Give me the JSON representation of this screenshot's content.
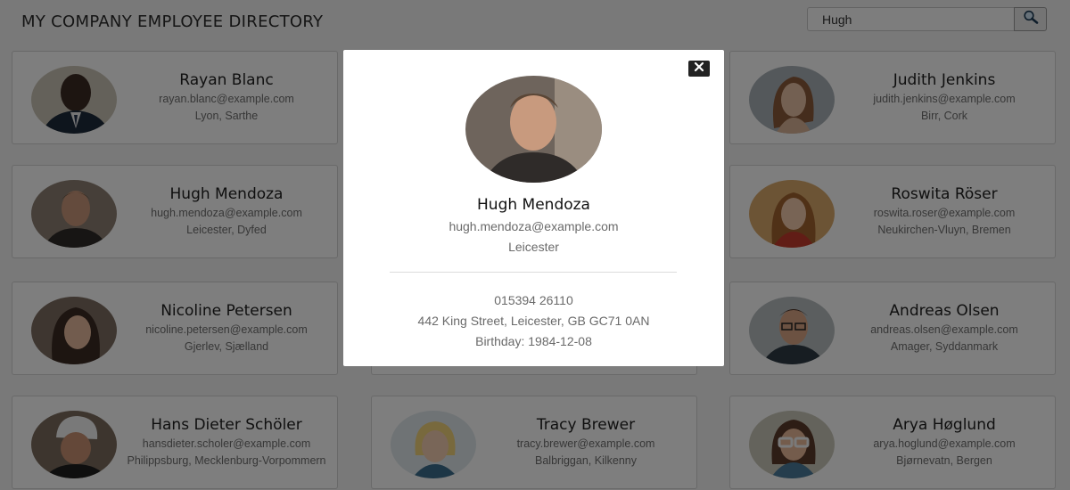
{
  "header": {
    "title": "MY COMPANY EMPLOYEE DIRECTORY",
    "search_value": "Hugh",
    "search_icon": "magnifier-icon"
  },
  "employees": [
    {
      "name": "Rayan Blanc",
      "email": "rayan.blanc@example.com",
      "location": "Lyon, Sarthe"
    },
    {
      "name": "",
      "email": "",
      "location": ""
    },
    {
      "name": "Judith Jenkins",
      "email": "judith.jenkins@example.com",
      "location": "Birr, Cork"
    },
    {
      "name": "Hugh Mendoza",
      "email": "hugh.mendoza@example.com",
      "location": "Leicester, Dyfed"
    },
    {
      "name": "",
      "email": "",
      "location": ""
    },
    {
      "name": "Roswita Röser",
      "email": "roswita.roser@example.com",
      "location": "Neukirchen-Vluyn, Bremen"
    },
    {
      "name": "Nicoline Petersen",
      "email": "nicoline.petersen@example.com",
      "location": "Gjerlev, Sjælland"
    },
    {
      "name": "",
      "email": "",
      "location": ""
    },
    {
      "name": "Andreas Olsen",
      "email": "andreas.olsen@example.com",
      "location": "Amager, Syddanmark"
    },
    {
      "name": "Hans Dieter Schöler",
      "email": "hansdieter.scholer@example.com",
      "location": "Philippsburg, Mecklenburg-Vorpommern"
    },
    {
      "name": "Tracy Brewer",
      "email": "tracy.brewer@example.com",
      "location": "Balbriggan, Kilkenny"
    },
    {
      "name": "Arya Høglund",
      "email": "arya.hoglund@example.com",
      "location": "Bjørnevatn, Bergen"
    }
  ],
  "modal": {
    "name": "Hugh Mendoza",
    "email": "hugh.mendoza@example.com",
    "city": "Leicester",
    "phone": "015394 26110",
    "address": "442 King Street, Leicester, GB GC71 0AN",
    "birthday": "Birthday: 1984-12-08",
    "close_icon": "close-icon"
  },
  "colors": {
    "overlay": "#00000080",
    "modal_bg": "#ffffff",
    "page_bg": "#f2f2f2"
  }
}
